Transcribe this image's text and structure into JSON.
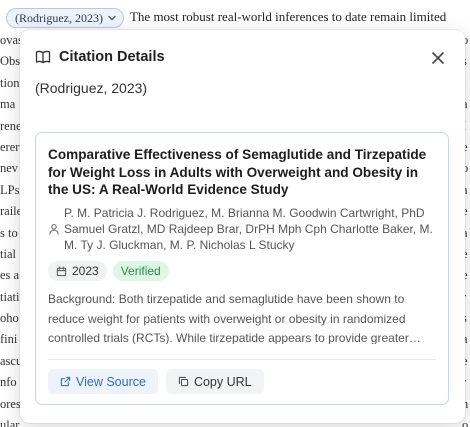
{
  "document": {
    "citation_chip": "(Rodriguez, 2023)",
    "top_text": "The most robust real-world inferences to date remain limited",
    "left_fragments": [
      "ovas",
      "Obse",
      "tion",
      "ma",
      "rene",
      "erer",
      "nev",
      "LPs",
      "raile",
      "s to",
      "tial",
      "es a",
      "tiati",
      "oho",
      "fini",
      "ascu",
      "nfo",
      "ores",
      "ular"
    ],
    "right_fragments": [
      "o",
      "s",
      "i",
      "a",
      "I",
      "e",
      "o",
      "a",
      "e",
      "a",
      "e",
      "e",
      "r",
      "s",
      "a",
      "e",
      "r",
      "n",
      "o"
    ]
  },
  "popover": {
    "title": "Citation Details",
    "citation": "(Rodriguez, 2023)",
    "icons": {
      "header": "book-open-icon",
      "close": "close-icon"
    }
  },
  "card": {
    "title": "Comparative Effectiveness of Semaglutide and Tirzepatide for Weight Loss in Adults with Overweight and Obesity in the US: A Real-World Evidence Study",
    "authors": "P. M. Patricia J. Rodriguez, M. Brianna M. Goodwin Cartwright, PhD Samuel Gratzl, MD Rajdeep Brar, DrPH Mph Cph Charlotte Baker, M. M. Ty J. Gluckman, M. P. Nicholas L Stucky",
    "year": "2023",
    "status": "Verified",
    "abstract": "Background: Both tirzepatide and semaglutide have been shown to reduce weight for patients with overweight or obesity in randomized controlled trials (RCTs). While tirzepatide appears to provide greater weight loss than semaglutide in trials, real-world evidence comparing the two is limited.",
    "actions": {
      "view_source": "View Source",
      "copy_url": "Copy URL"
    },
    "colors": {
      "verified_bg": "#def6e5",
      "verified_text": "#2f8a4c",
      "link": "#2e6bc6",
      "card_border": "#c9d7ea"
    }
  }
}
